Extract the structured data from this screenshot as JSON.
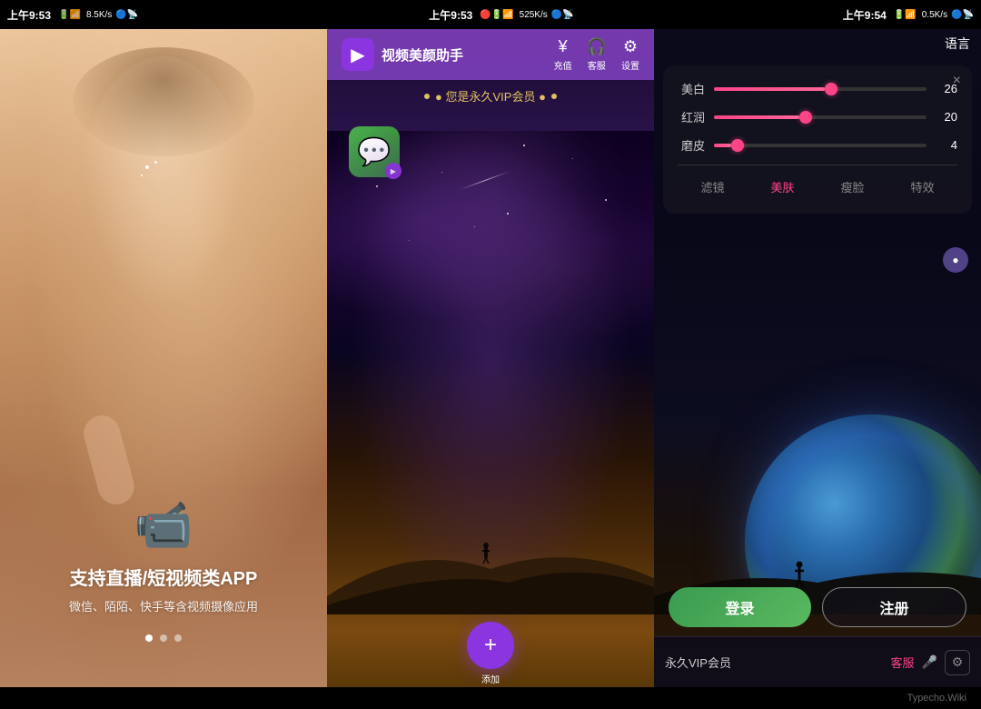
{
  "topbar": {
    "time1": "上午9:53",
    "speed1": "8.5K/s",
    "time2": "上午9:53",
    "speed2": "525K/s",
    "time3": "上午9:54",
    "speed3": "0.5K/s"
  },
  "panel1": {
    "title": "支持直播/短视频类APP",
    "subtitle": "微信、陌陌、快手等含视频摄像应用",
    "dots": [
      "active",
      "",
      ""
    ]
  },
  "panel2": {
    "app_name": "视频美颜助手",
    "actions": {
      "recharge": "充值",
      "customer": "客服",
      "settings": "设置"
    },
    "vip_text": "● 您是永久VIP会员 ●",
    "wechat_label": "微信",
    "add_label": "添加"
  },
  "panel3": {
    "language_btn": "语言",
    "close_btn": "×",
    "sliders": [
      {
        "label": "美白",
        "value": 26,
        "percent": 52
      },
      {
        "label": "红润",
        "value": 20,
        "percent": 40
      },
      {
        "label": "磨皮",
        "value": 4,
        "percent": 8
      }
    ],
    "tabs": [
      {
        "label": "滤镜",
        "active": false
      },
      {
        "label": "美肤",
        "active": true
      },
      {
        "label": "瘦脸",
        "active": false
      },
      {
        "label": "特效",
        "active": false
      }
    ],
    "vip_label": "永久VIP会员",
    "customer_label": "客服",
    "login_btn": "登录",
    "register_btn": "注册"
  },
  "attribution": "Typecho.Wiki"
}
